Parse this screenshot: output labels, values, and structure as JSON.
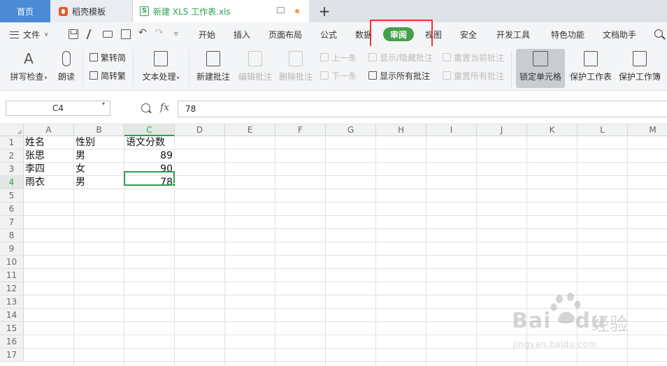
{
  "tabs": {
    "home": "首页",
    "template": "稻壳模板",
    "document": "新建 XLS 工作表.xls",
    "logo_s": "S"
  },
  "quick_glyphs": {
    "undo": "↶",
    "redo": "↷",
    "more": "▿"
  },
  "menu": {
    "file": "文件",
    "items": [
      "开始",
      "插入",
      "页面布局",
      "公式",
      "数据",
      "审阅",
      "视图",
      "安全",
      "开发工具",
      "特色功能",
      "文档助手"
    ],
    "active": "审阅"
  },
  "ribbon": {
    "spell_check": "拼写检查",
    "read_aloud": "朗读",
    "trad_to_simp": "繁转简",
    "simp_to_trad": "简转繁",
    "text_processing": "文本处理",
    "new_comment": "新建批注",
    "edit_comment": "编辑批注",
    "delete_comment": "删除批注",
    "prev": "上一条",
    "next": "下一条",
    "show_hide_comment": "显示/隐藏批注",
    "show_all_comments": "显示所有批注",
    "reset_current_comment": "重置当前批注",
    "reset_all_comments": "重置所有批注",
    "lock_cell": "锁定单元格",
    "protect_sheet": "保护工作表",
    "protect_workbook": "保护工作簿",
    "spell_glyph": "A"
  },
  "formula_bar": {
    "name_box": "C4",
    "fx": "fx",
    "value": "78"
  },
  "grid": {
    "columns": [
      "A",
      "B",
      "C",
      "D",
      "E",
      "F",
      "G",
      "H",
      "I",
      "J",
      "K",
      "L",
      "M"
    ],
    "selected_column": "C",
    "rows": [
      "1",
      "2",
      "3",
      "4",
      "5",
      "6",
      "7",
      "8",
      "9",
      "10",
      "11",
      "12",
      "13",
      "14",
      "15",
      "16",
      "17"
    ],
    "selected_row": "4",
    "cells": {
      "A1": "姓名",
      "B1": "性别",
      "C1": "语文分数",
      "A2": "张思",
      "B2": "男",
      "C2": "89",
      "A3": "李四",
      "B3": "女",
      "C3": "90",
      "A4": "雨衣",
      "B4": "男",
      "C4": "78"
    }
  },
  "watermark": {
    "brand": "Bai",
    "brand2": "du",
    "cn": "经验",
    "url": "jingyan.baidu.com"
  },
  "colors": {
    "accent_green": "#2e9e4f",
    "active_tab_pill": "#43a047",
    "home_tab": "#4b8bd6",
    "highlight_red": "#e53935"
  }
}
